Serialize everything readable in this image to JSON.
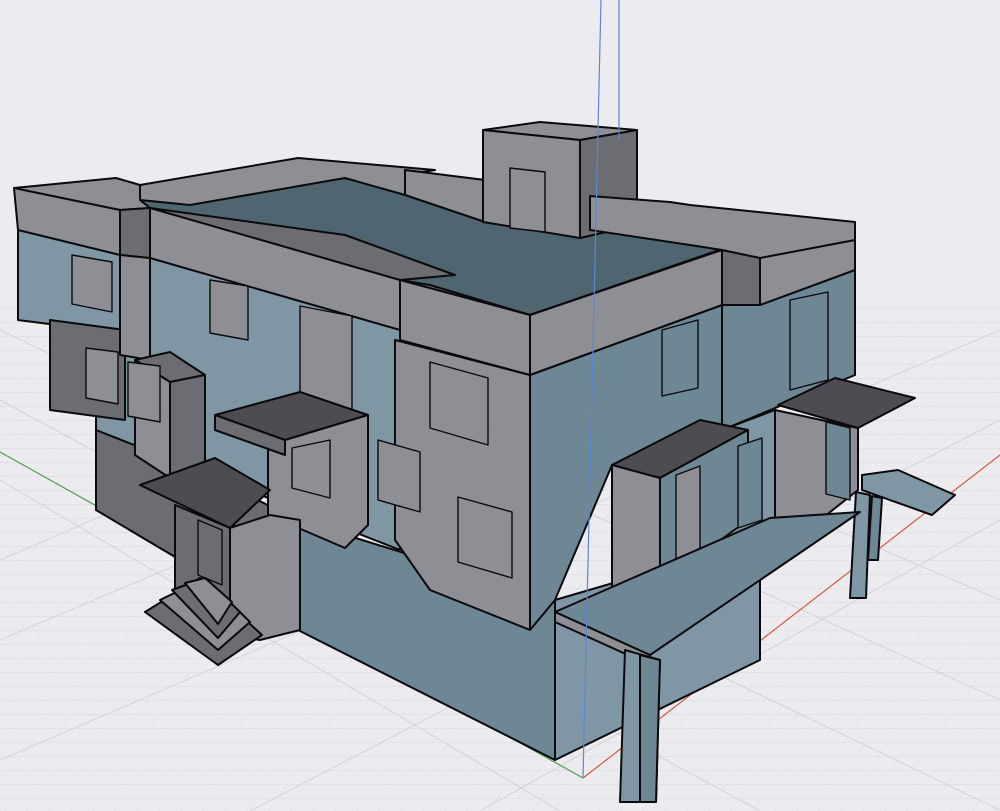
{
  "viewport": {
    "background": "#ececf0",
    "grid_minor_color": "#d9d9de",
    "grid_major_color": "#c8c8ce"
  },
  "axes": {
    "x_axis_color": "#d8573e",
    "y_axis_color": "#4f9a4f",
    "z_axis_color": "#5a86d6"
  },
  "model": {
    "wall_top_color": "#8e8e95",
    "wall_side_color": "#6c6c73",
    "wall_blue_color": "#6e8795",
    "wall_blue_light_color": "#7f97a4",
    "roof_color": "#4f6670",
    "canopy_top_color": "#4c4c52",
    "edge_color": "#0a0a0c"
  }
}
